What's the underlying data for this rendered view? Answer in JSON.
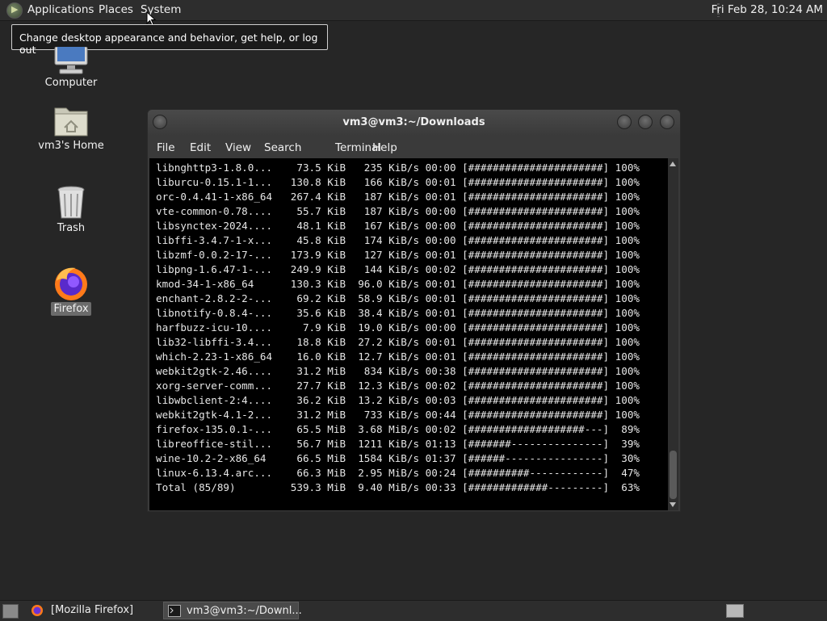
{
  "top_panel": {
    "menus": [
      "Applications",
      "Places",
      "System"
    ],
    "clock": "Fri Feb 28, 10:24 AM"
  },
  "tooltip": {
    "text": "Change desktop appearance and behavior, get help, or log out"
  },
  "desktop": {
    "icons": [
      {
        "label": "Computer",
        "icon": "computer-icon"
      },
      {
        "label": "vm3's Home",
        "icon": "home-folder-icon"
      },
      {
        "label": "Trash",
        "icon": "trash-icon"
      },
      {
        "label": "Firefox",
        "icon": "firefox-icon",
        "selected": true
      }
    ]
  },
  "terminal": {
    "title": "vm3@vm3:~/Downloads",
    "menu": [
      "File",
      "Edit",
      "View",
      "Search",
      "Terminal",
      "Help"
    ],
    "lines": [
      "libnghttp3-1.8.0...    73.5 KiB   235 KiB/s 00:00 [######################] 100%",
      "liburcu-0.15.1-1...   130.8 KiB   166 KiB/s 00:01 [######################] 100%",
      "orc-0.4.41-1-x86_64   267.4 KiB   187 KiB/s 00:01 [######################] 100%",
      "vte-common-0.78....    55.7 KiB   187 KiB/s 00:00 [######################] 100%",
      "libsynctex-2024....    48.1 KiB   167 KiB/s 00:00 [######################] 100%",
      "libffi-3.4.7-1-x...    45.8 KiB   174 KiB/s 00:00 [######################] 100%",
      "libzmf-0.0.2-17-...   173.9 KiB   127 KiB/s 00:01 [######################] 100%",
      "libpng-1.6.47-1-...   249.9 KiB   144 KiB/s 00:02 [######################] 100%",
      "kmod-34-1-x86_64      130.3 KiB  96.0 KiB/s 00:01 [######################] 100%",
      "enchant-2.8.2-2-...    69.2 KiB  58.9 KiB/s 00:01 [######################] 100%",
      "libnotify-0.8.4-...    35.6 KiB  38.4 KiB/s 00:01 [######################] 100%",
      "harfbuzz-icu-10....     7.9 KiB  19.0 KiB/s 00:00 [######################] 100%",
      "lib32-libffi-3.4...    18.8 KiB  27.2 KiB/s 00:01 [######################] 100%",
      "which-2.23-1-x86_64    16.0 KiB  12.7 KiB/s 00:01 [######################] 100%",
      "webkit2gtk-2.46....    31.2 MiB   834 KiB/s 00:38 [######################] 100%",
      "xorg-server-comm...    27.7 KiB  12.3 KiB/s 00:02 [######################] 100%",
      "libwbclient-2:4....    36.2 KiB  13.2 KiB/s 00:03 [######################] 100%",
      "webkit2gtk-4.1-2...    31.2 MiB   733 KiB/s 00:44 [######################] 100%",
      "firefox-135.0.1-...    65.5 MiB  3.68 MiB/s 00:02 [###################---]  89%",
      "libreoffice-stil...    56.7 MiB  1211 KiB/s 01:13 [#######---------------]  39%",
      "wine-10.2-2-x86_64     66.5 MiB  1584 KiB/s 01:37 [######----------------]  30%",
      "linux-6.13.4.arc...    66.3 MiB  2.95 MiB/s 00:24 [##########------------]  47%",
      "Total (85/89)         539.3 MiB  9.40 MiB/s 00:33 [#############---------]  63%"
    ]
  },
  "taskbar": {
    "tasks": [
      {
        "label": "[Mozilla Firefox]",
        "icon": "firefox-icon"
      },
      {
        "label": "vm3@vm3:~/Downl...",
        "icon": "terminal-icon",
        "active": true
      }
    ]
  },
  "colors": {
    "desktop_bg": "#262626",
    "panel_bg": "#2d2d2d",
    "terminal_bg": "#000000"
  }
}
